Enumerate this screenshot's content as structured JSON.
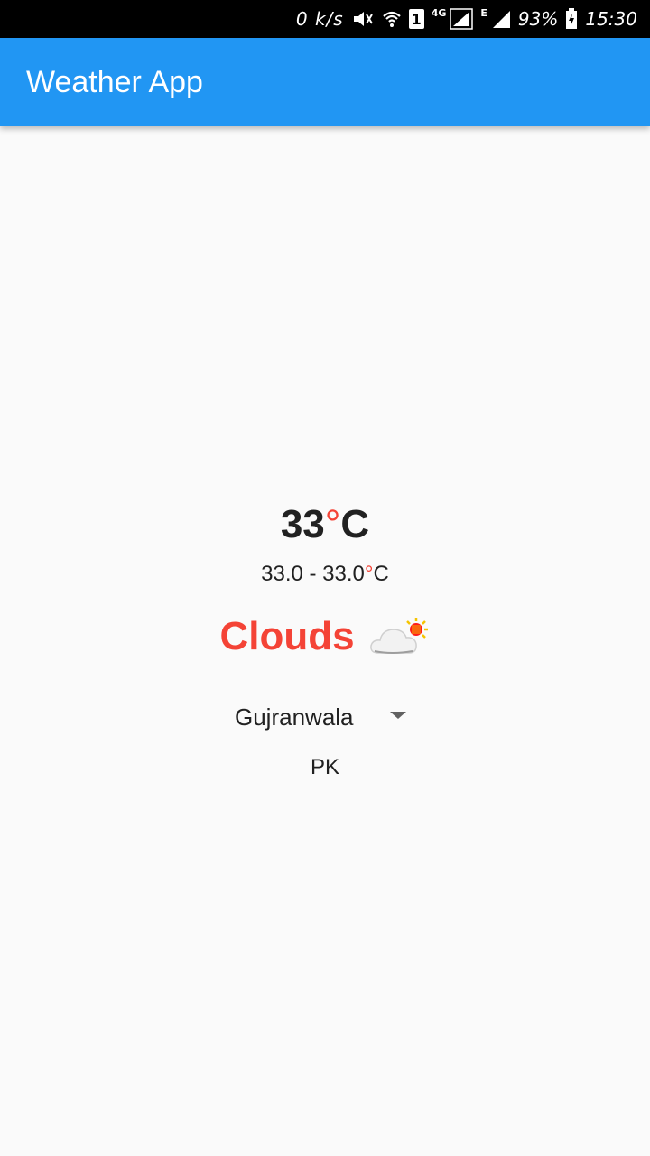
{
  "status_bar": {
    "speed": "0 k/s",
    "sim_number": "1",
    "network_4g": "4G",
    "network_e": "E",
    "battery": "93%",
    "time": "15:30"
  },
  "app_bar": {
    "title": "Weather App",
    "color": "#2196f3"
  },
  "weather": {
    "temp_value": "33",
    "temp_unit_symbol": "°",
    "temp_unit": "C",
    "range_text": "33.0 - 33.0",
    "range_unit_symbol": "°",
    "range_unit": "C",
    "condition": "Clouds",
    "condition_icon": "cloud-sun-icon",
    "accent_color": "#f44336"
  },
  "location": {
    "city": "Gujranwala",
    "country": "PK"
  }
}
